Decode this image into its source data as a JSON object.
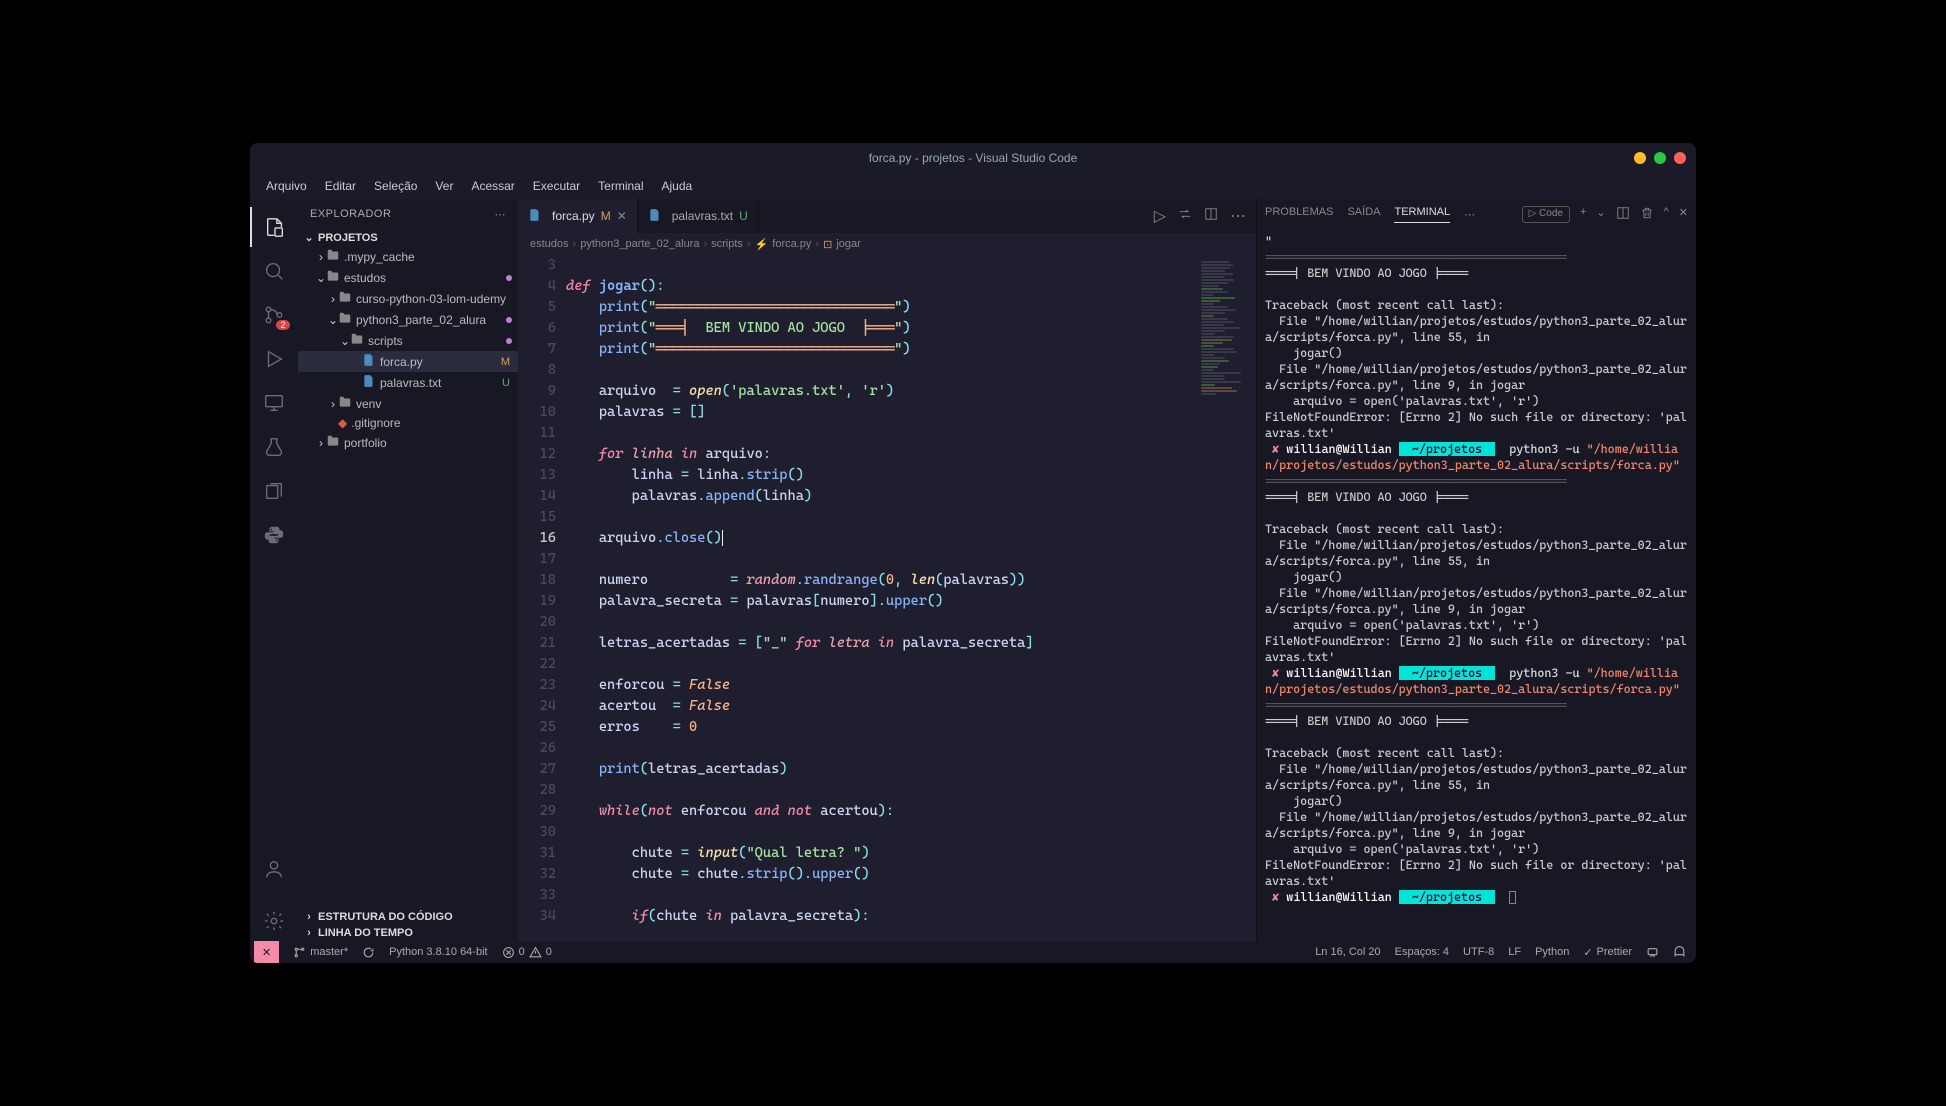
{
  "window": {
    "title": "forca.py - projetos - Visual Studio Code"
  },
  "menu": [
    "Arquivo",
    "Editar",
    "Seleção",
    "Ver",
    "Acessar",
    "Executar",
    "Terminal",
    "Ajuda"
  ],
  "activitybar": {
    "source_control_badge": "2"
  },
  "sidebar": {
    "title": "EXPLORADOR",
    "project": "PROJETOS",
    "tree": [
      {
        "depth": 1,
        "icon": "folder",
        "label": ".mypy_cache",
        "chev": "›"
      },
      {
        "depth": 1,
        "icon": "folder",
        "label": "estudos",
        "chev": "⌄",
        "dot": true
      },
      {
        "depth": 2,
        "icon": "folder",
        "label": "curso-python-03-lom-udemy",
        "chev": "›"
      },
      {
        "depth": 2,
        "icon": "folder",
        "label": "python3_parte_02_alura",
        "chev": "⌄",
        "dot": true
      },
      {
        "depth": 3,
        "icon": "folder",
        "label": "scripts",
        "chev": "⌄",
        "dot": true
      },
      {
        "depth": 4,
        "icon": "py",
        "label": "forca.py",
        "status": "M",
        "status_cls": "m",
        "selected": true
      },
      {
        "depth": 4,
        "icon": "txt",
        "label": "palavras.txt",
        "status": "U",
        "status_cls": "u"
      },
      {
        "depth": 2,
        "icon": "folder",
        "label": "venv",
        "chev": "›"
      },
      {
        "depth": 2,
        "icon": "git",
        "label": ".gitignore"
      },
      {
        "depth": 1,
        "icon": "folder",
        "label": "portfolio",
        "chev": "›"
      }
    ],
    "outline": "ESTRUTURA DO CÓDIGO",
    "timeline": "LINHA DO TEMPO"
  },
  "tabs": [
    {
      "icon": "py",
      "label": "forca.py",
      "status": "M",
      "status_cls": "m",
      "active": true,
      "close": true
    },
    {
      "icon": "txt",
      "label": "palavras.txt",
      "status": "U",
      "status_cls": "u",
      "active": false
    }
  ],
  "breadcrumbs": [
    "estudos",
    "python3_parte_02_alura",
    "scripts",
    "forca.py",
    "jogar"
  ],
  "code": {
    "first_line": 3,
    "current_line": 16,
    "lines": [
      "",
      "<kw>def</kw> <fnname>jogar</fnname><op>()</op><op>:</op>",
      "    <fn>print</fn><op>(</op><str>\"</str><strbar>═════════════════════════════</strbar><str>\"</str><op>)</op>",
      "    <fn>print</fn><op>(</op><str>\"</str><strbar>═══╡</strbar><str>  BEM VINDO AO JOGO  </str><strbar>╞═══</strbar><str>\"</str><op>)</op>",
      "    <fn>print</fn><op>(</op><str>\"</str><strbar>═════════════════════════════</strbar><str>\"</str><op>)</op>",
      "",
      "    arquivo  <op>=</op> <builtin>open</builtin><op>(</op><str>'palavras.txt'</str><op>,</op> <str>'r'</str><op>)</op>",
      "    palavras <op>=</op> <op>[]</op>",
      "",
      "    <kw>for</kw> <param>linha</param> <kw>in</kw> arquivo<op>:</op>",
      "        linha <op>=</op> linha<op>.</op><fn>strip</fn><op>()</op>",
      "        palavras<op>.</op><fn>append</fn><op>(</op>linha<op>)</op>",
      "",
      "    arquivo<op>.</op><fn>close</fn><op>()</op><cursor></cursor>",
      "",
      "    numero          <op>=</op> <param>random</param><op>.</op><fn>randrange</fn><op>(</op><num>0</num><op>,</op> <builtin>len</builtin><op>(</op>palavras<op>))</op>",
      "    palavra_secreta <op>=</op> palavras<op>[</op>numero<op>].</op><fn>upper</fn><op>()</op>",
      "",
      "    letras_acertadas <op>=</op> <op>[</op><str>\"_\"</str> <kw>for</kw> <param>letra</param> <kw>in</kw> palavra_secreta<op>]</op>",
      "",
      "    enforcou <op>=</op> <const>False</const>",
      "    acertou  <op>=</op> <const>False</const>",
      "    erros    <op>=</op> <num>0</num>",
      "",
      "    <fn>print</fn><op>(</op>letras_acertadas<op>)</op>",
      "",
      "    <kw>while</kw><op>(</op><kw>not</kw> enforcou <kw>and</kw> <kw>not</kw> acertou<op>):</op>",
      "",
      "        chute <op>=</op> <builtin>input</builtin><op>(</op><str>\"Qual letra? \"</str><op>)</op>",
      "        chute <op>=</op> chute<op>.</op><fn>strip</fn><op>().</op><fn>upper</fn><op>()</op>",
      "",
      "        <kw>if</kw><op>(</op>chute <kw>in</kw> palavra_secreta<op>):</op>"
    ]
  },
  "panel": {
    "tabs": [
      "PROBLEMAS",
      "SAÍDA",
      "TERMINAL"
    ],
    "active": "TERMINAL",
    "code_label": "Code"
  },
  "terminal": {
    "divider": "===========================================",
    "banner": "====| BEM VINDO AO JOGO |====",
    "quote": "\"",
    "traceback": "Traceback (most recent call last):",
    "file1": "  File \"/home/willian/projetos/estudos/python3_parte_02_alura/scripts/forca.py\", line 55, in <module>",
    "call1": "    jogar()",
    "file2": "  File \"/home/willian/projetos/estudos/python3_parte_02_alura/scripts/forca.py\", line 9, in jogar",
    "call2": "    arquivo = open('palavras.txt', 'r')",
    "error": "FileNotFoundError: [Errno 2] No such file or directory: 'palavras.txt'",
    "prompt_user": "willian@Willian",
    "prompt_path": "~/projetos",
    "cmd": "python3 -u ",
    "cmd_path1": "\"/home/willian/projetos/estudos/python3_parte_02_alura/scripts/forca.py\"",
    "cmd_path2": "\"/home/willian/projetos/estudos/python3_parte_02_alura/scripts/forca.py\""
  },
  "statusbar": {
    "branch": "master*",
    "python": "Python 3.8.10 64-bit",
    "problems": "0",
    "warnings": "0",
    "cursor": "Ln 16, Col 20",
    "spaces": "Espaços: 4",
    "encoding": "UTF-8",
    "eol": "LF",
    "lang": "Python",
    "prettier": "Prettier"
  }
}
